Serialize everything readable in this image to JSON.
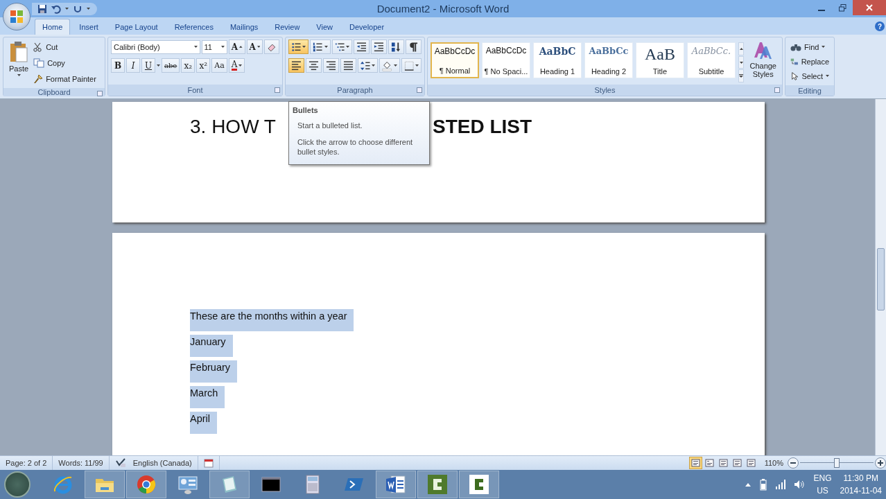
{
  "window": {
    "title": "Document2 - Microsoft Word",
    "help": "?"
  },
  "tabs": [
    {
      "label": "Home",
      "selected": true
    },
    {
      "label": "Insert",
      "selected": false
    },
    {
      "label": "Page Layout",
      "selected": false
    },
    {
      "label": "References",
      "selected": false
    },
    {
      "label": "Mailings",
      "selected": false
    },
    {
      "label": "Review",
      "selected": false
    },
    {
      "label": "View",
      "selected": false
    },
    {
      "label": "Developer",
      "selected": false
    }
  ],
  "ribbon": {
    "clipboard": {
      "label": "Clipboard",
      "paste": "Paste",
      "items": [
        {
          "label": "Cut",
          "kind": "cut"
        },
        {
          "label": "Copy",
          "kind": "copy"
        },
        {
          "label": "Format Painter",
          "kind": "painter"
        }
      ]
    },
    "font": {
      "label": "Font",
      "font_name": "Calibri (Body)",
      "font_size": "11",
      "size_buttons": [
        {
          "text": "A",
          "kind": "grow"
        },
        {
          "text": "A",
          "kind": "shrink"
        }
      ],
      "format_buttons": [
        {
          "text": "B",
          "kind": "bold"
        },
        {
          "text": "I",
          "kind": "italic"
        },
        {
          "text": "U",
          "kind": "underline"
        },
        {
          "text": "abe",
          "kind": "strike"
        },
        {
          "text": "x₂",
          "kind": "sub"
        },
        {
          "text": "x²",
          "kind": "super"
        },
        {
          "text": "Aa",
          "kind": "case"
        },
        {
          "text": "A",
          "kind": "color"
        }
      ]
    },
    "paragraph": {
      "label": "Paragraph",
      "buttons": [
        {
          "kind": "bullets",
          "on": true
        },
        {
          "kind": "numbering",
          "on": false
        },
        {
          "kind": "multilevel",
          "on": false
        },
        {
          "kind": "outdent",
          "on": false
        },
        {
          "kind": "indent",
          "on": false
        },
        {
          "kind": "sort",
          "on": false
        },
        {
          "kind": "pilcrow",
          "on": false
        },
        {
          "kind": "left",
          "on": true
        },
        {
          "kind": "center",
          "on": false
        },
        {
          "kind": "right",
          "on": false
        },
        {
          "kind": "justify",
          "on": false
        },
        {
          "kind": "spacing",
          "on": false
        },
        {
          "kind": "shading",
          "on": false
        },
        {
          "kind": "borders",
          "on": false
        }
      ]
    },
    "styles": {
      "label": "Styles",
      "items": [
        {
          "sample": "AaBbCcDc",
          "name": "¶ Normal",
          "kind": "normal",
          "selected": true
        },
        {
          "sample": "AaBbCcDc",
          "name": "¶ No Spaci...",
          "kind": "normal",
          "selected": false
        },
        {
          "sample": "AaBbC",
          "name": "Heading 1",
          "kind": "heading1",
          "selected": false
        },
        {
          "sample": "AaBbCc",
          "name": "Heading 2",
          "kind": "heading2",
          "selected": false
        },
        {
          "sample": "AaB",
          "name": "Title",
          "kind": "title",
          "selected": false
        },
        {
          "sample": "AaBbCc.",
          "name": "Subtitle",
          "kind": "subtitle",
          "selected": false
        }
      ],
      "change_styles": "Change Styles"
    },
    "editing": {
      "label": "Editing",
      "items": [
        {
          "label": "Find",
          "kind": "find"
        },
        {
          "label": "Replace",
          "kind": "replace"
        },
        {
          "label": "Select",
          "kind": "select"
        }
      ]
    }
  },
  "tooltip": {
    "title": "Bullets",
    "lines": [
      "Start a bulleted list.",
      "Click the arrow to choose different bullet styles."
    ]
  },
  "document": {
    "heading_left": "3. HOW T",
    "heading_right": "STED LIST",
    "paragraphs": [
      {
        "text": "These are the months within a year",
        "selected": true
      },
      {
        "text": "January",
        "selected": true
      },
      {
        "text": "February",
        "selected": true
      },
      {
        "text": "March",
        "selected": true
      },
      {
        "text": "April",
        "selected": true
      }
    ]
  },
  "status_bar": {
    "page": "Page: 2 of 2",
    "words": "Words: 11/99",
    "language": "English (Canada)",
    "views": [
      {
        "selected": true
      },
      {
        "selected": false
      },
      {
        "selected": false
      },
      {
        "selected": false
      },
      {
        "selected": false
      }
    ],
    "zoom": "110%",
    "zoom_slider": {
      "level": 0.5
    }
  },
  "taskbar": {
    "apps": [
      {
        "kind": "ie",
        "running": false
      },
      {
        "kind": "folder",
        "running": true
      },
      {
        "kind": "chrome",
        "running": true
      },
      {
        "kind": "remote",
        "running": false
      },
      {
        "kind": "notes",
        "running": true
      },
      {
        "kind": "terminal",
        "running": false
      },
      {
        "kind": "calculator",
        "running": false
      },
      {
        "kind": "shell",
        "running": false
      },
      {
        "kind": "word",
        "running": true
      },
      {
        "kind": "recorder",
        "running": true
      },
      {
        "kind": "recorder2",
        "running": true
      }
    ],
    "language": "ENG",
    "region": "US",
    "time": "11:30 PM",
    "date": "2014-11-04"
  }
}
